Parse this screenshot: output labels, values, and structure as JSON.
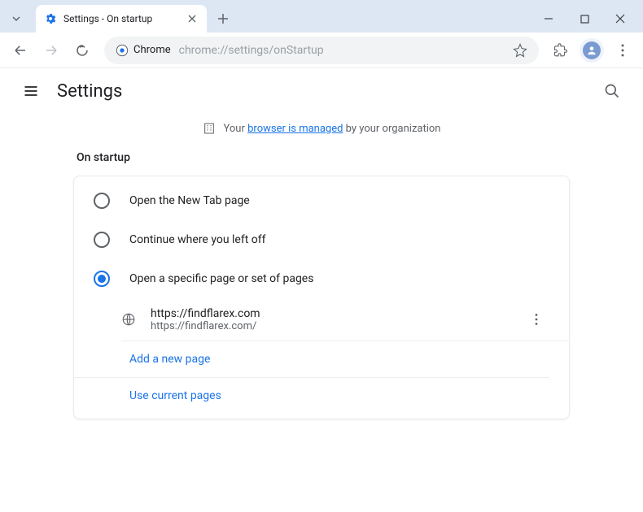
{
  "window": {
    "tab_title": "Settings - On startup",
    "url": "chrome://settings/onStartup",
    "omnibox_chip": "Chrome"
  },
  "settings": {
    "title": "Settings",
    "managed_prefix": "Your ",
    "managed_link": "browser is managed",
    "managed_suffix": " by your organization",
    "section_label": "On startup",
    "options": {
      "opt1": "Open the New Tab page",
      "opt2": "Continue where you left off",
      "opt3": "Open a specific page or set of pages"
    },
    "page": {
      "title": "https://findflarex.com",
      "url": "https://findflarex.com/"
    },
    "add_page": "Add a new page",
    "use_current": "Use current pages"
  }
}
